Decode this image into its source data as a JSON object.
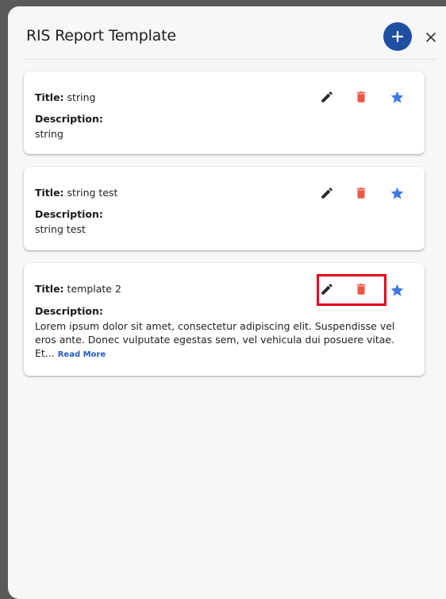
{
  "header": {
    "title": "RIS Report Template",
    "add_icon": "plus-icon",
    "close_icon": "close-icon"
  },
  "templates": [
    {
      "title_label": "Title:",
      "title": "string",
      "description_label": "Description:",
      "description": "string",
      "read_more": ""
    },
    {
      "title_label": "Title:",
      "title": "string test",
      "description_label": "Description:",
      "description": "string test",
      "read_more": ""
    },
    {
      "title_label": "Title:",
      "title": "template 2",
      "description_label": "Description:",
      "description": "Lorem ipsum dolor sit amet, consectetur adipiscing elit. Suspendisse vel eros ante. Donec vulputate egestas sem, vel vehicula dui posuere vitae. Et...",
      "read_more": "Read More"
    }
  ],
  "icons": {
    "edit": "pencil-icon",
    "delete": "trash-icon",
    "favorite": "star-icon"
  },
  "colors": {
    "accent": "#1e4fa1",
    "delete": "#f05545",
    "star": "#3b7be0",
    "highlight": "#e0001b"
  }
}
